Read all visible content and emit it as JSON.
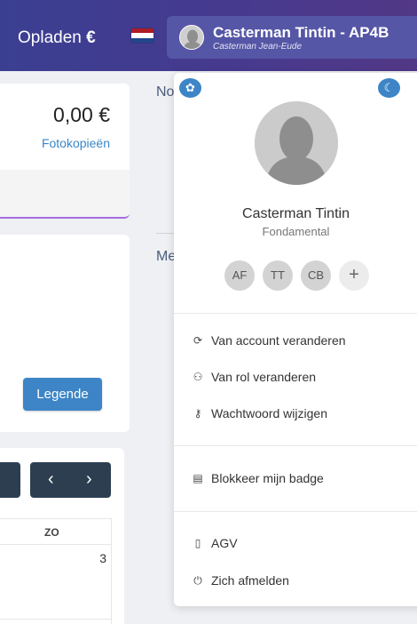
{
  "header": {
    "topup_label": "Opladen",
    "topup_currency": "€",
    "language_flag": "nl-flag-icon",
    "user": {
      "name": "Casterman Tintin - AP4B",
      "subtitle": "Casterman Jean-Eude"
    }
  },
  "background": {
    "balance": "0,00 €",
    "photocopies_link": "Fotokopieën",
    "legend_button": "Legende",
    "nav": {
      "prev": "‹",
      "next": "›"
    },
    "calendar": {
      "day_header": "ZO",
      "cell_number": "3"
    },
    "right_panel": {
      "heading_1_partial": "No",
      "heading_2_partial": "Me"
    }
  },
  "profile_menu": {
    "name": "Casterman Tintin",
    "role": "Fondamental",
    "accounts": [
      "AF",
      "TT",
      "CB"
    ],
    "add_account": "+",
    "items_group1": [
      {
        "label": "Van account veranderen",
        "icon": "switch-account-icon",
        "glyph": "⟳"
      },
      {
        "label": "Van rol veranderen",
        "icon": "switch-role-icon",
        "glyph": "⚇"
      },
      {
        "label": "Wachtwoord wijzigen",
        "icon": "key-icon",
        "glyph": "⚷"
      }
    ],
    "items_group2": [
      {
        "label": "Blokkeer mijn badge",
        "icon": "badge-icon",
        "glyph": "▤"
      }
    ],
    "items_group3": [
      {
        "label": "AGV",
        "icon": "document-icon",
        "glyph": "▯"
      },
      {
        "label": "Zich afmelden",
        "icon": "power-icon",
        "glyph": "⏻"
      }
    ],
    "corner_left_icon": "palette-icon",
    "corner_right_icon": "moon-icon"
  },
  "colors": {
    "header_gradient_start": "#3b3f92",
    "header_gradient_end": "#523886",
    "accent_blue": "#3d85c6",
    "dark_nav": "#2c3e50"
  }
}
